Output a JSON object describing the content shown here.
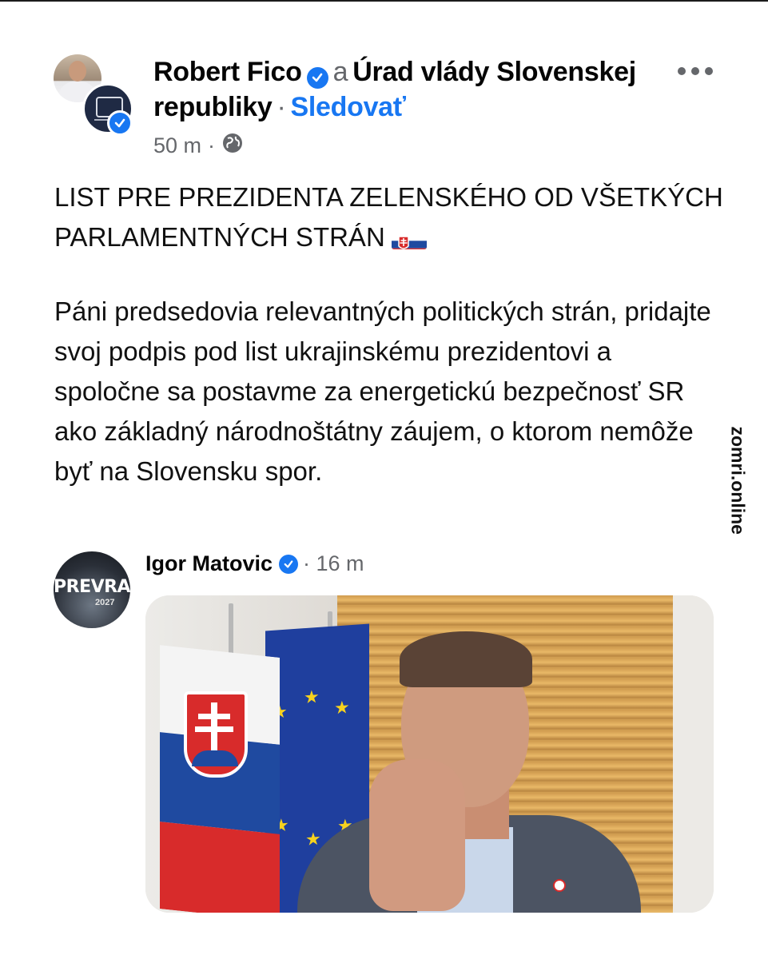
{
  "post": {
    "author_primary": "Robert Fico",
    "conjunction": "a",
    "author_secondary": "Úrad vlády Slovenskej republiky",
    "separator": "·",
    "follow_label": "Sledovať",
    "time": "50 m",
    "meta_separator": "·",
    "audience_icon": "globe-icon",
    "title": "LIST PRE PREZIDENTA ZELENSKÉHO OD VŠETKÝCH PARLAMENTNÝCH STRÁN",
    "body": "Páni predsedovia relevantných politických strán, pridajte svoj podpis pod list ukrajinskému prezidentovi a spoločne sa postavme za energetickú bezpečnosť SR ako základný národnoštátny záujem, o ktorom nemôže byť na Slovensku spor."
  },
  "watermark": "zomri.online",
  "shared_post": {
    "author": "Igor Matovic",
    "time": "· 16 m",
    "avatar_text": "PREVRAT",
    "avatar_year": "2027"
  },
  "colors": {
    "accent": "#1877f2",
    "secondary_text": "#65676b",
    "text": "#050505"
  }
}
